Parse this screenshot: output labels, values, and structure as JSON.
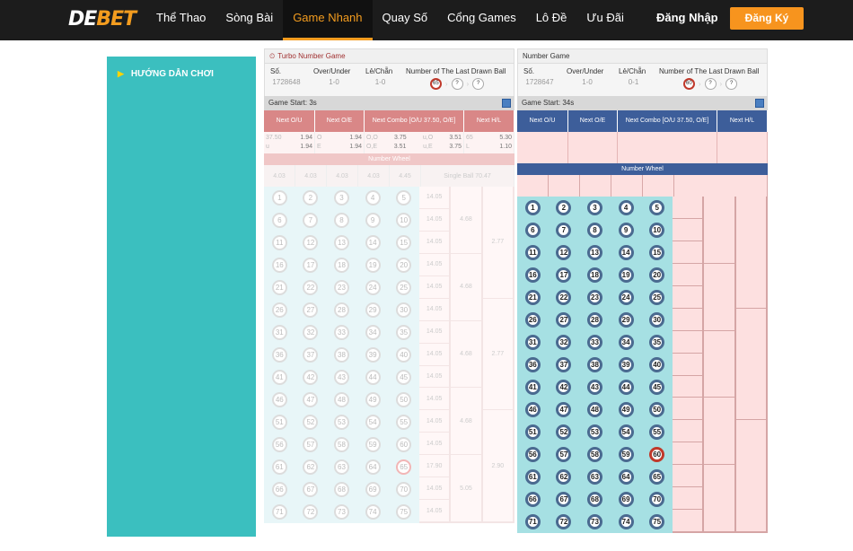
{
  "header": {
    "logo": {
      "a": "DE",
      "b": "BET"
    },
    "nav": [
      "Thể Thao",
      "Sòng Bài",
      "Game Nhanh",
      "Quay Số",
      "Cổng Games",
      "Lô Đề",
      "Ưu Đãi"
    ],
    "active": "Game Nhanh",
    "login": "Đăng Nhập",
    "register": "Đăng Ký"
  },
  "sidebar": {
    "item": "HƯỚNG DẪN CHƠI"
  },
  "panels": [
    {
      "title": "Turbo Number Game",
      "so_label": "Số.",
      "so": "1728648",
      "ou_label": "Over/Under",
      "ou": "1-0",
      "lc_label": "Lẻ/Chẵn",
      "lc": "1-0",
      "last_label": "Number of The Last Drawn Ball",
      "last": [
        "65",
        "?",
        "?"
      ],
      "game_start": "Game Start: 3s",
      "h": {
        "ou": "Next O/U",
        "oe": "Next O/E",
        "combo": "Next Combo [O/U 37.50, O/E]",
        "hl": "Next H/L"
      },
      "odds": {
        "ou": [
          [
            "37.50",
            "1.94"
          ],
          [
            "u",
            "1.94"
          ]
        ],
        "oe": [
          [
            "O",
            "1.94"
          ],
          [
            "E",
            "1.94"
          ]
        ],
        "combo": [
          [
            "O,O",
            "3.75",
            "u,O",
            "3.51"
          ],
          [
            "O,E",
            "3.51",
            "u,E",
            "3.75"
          ]
        ],
        "hl": [
          [
            "65",
            "5.30"
          ],
          [
            "L",
            "1.10"
          ]
        ]
      },
      "nw_label": "Number Wheel",
      "nw": [
        "4.03",
        "4.03",
        "4.03",
        "4.03",
        "4.45",
        "Single Ball  70.47"
      ],
      "row_odds": [
        "14.05",
        "14.05",
        "14.05",
        "14.05",
        "14.05",
        "14.05",
        "14.05",
        "14.05",
        "14.05",
        "14.05",
        "14.05",
        "14.05",
        "17.90",
        "14.05",
        "14.05"
      ],
      "group5": [
        "4.68",
        "4.68",
        "4.68",
        "4.68",
        "5.05"
      ],
      "group3": [
        "2.77",
        "2.77",
        "2.90"
      ],
      "hot": 65
    },
    {
      "title": "Number Game",
      "so_label": "Số.",
      "so": "1728647",
      "ou_label": "Over/Under",
      "ou": "1-0",
      "lc_label": "Lẻ/Chẵn",
      "lc": "0-1",
      "last_label": "Number of The Last Drawn Ball",
      "last": [
        "60",
        "?",
        "?"
      ],
      "game_start": "Game Start: 34s",
      "h": {
        "ou": "Next O/U",
        "oe": "Next O/E",
        "combo": "Next Combo [O/U 37.50, O/E]",
        "hl": "Next H/L"
      },
      "nw_label": "Number Wheel",
      "hot": 60
    }
  ]
}
